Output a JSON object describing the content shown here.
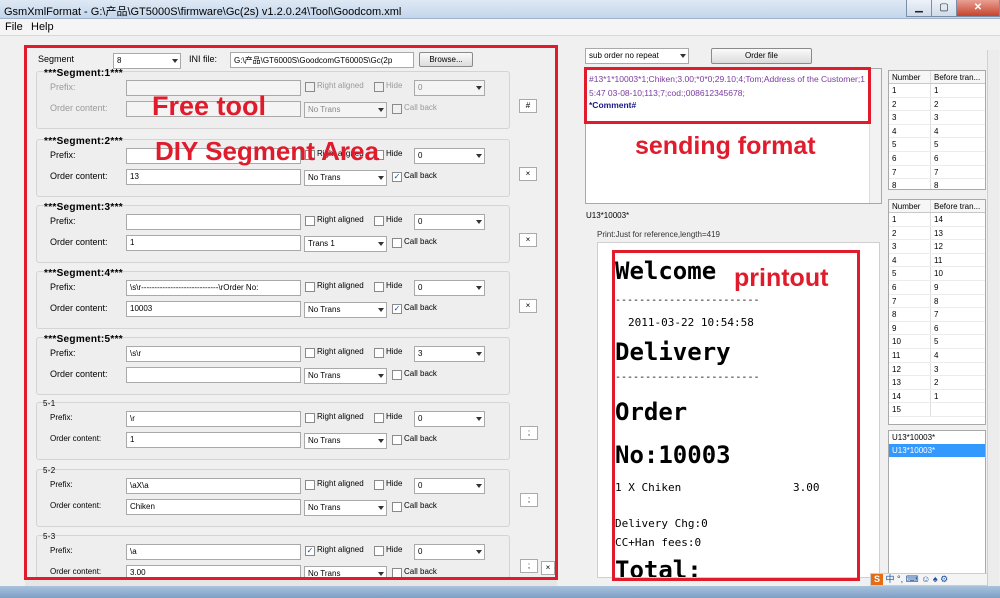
{
  "window": {
    "title": "GsmXmlFormat - G:\\产品\\GT5000S\\firmware\\Gc(2s) v1.2.0.24\\Tool\\Goodcom.xml",
    "min": "▁",
    "max": "▢",
    "close": "✕"
  },
  "menu": [
    "File",
    "Help"
  ],
  "top": {
    "segment_label": "Segment",
    "segment_value": "8",
    "ini_label": "INI file:",
    "ini_value": "G:\\产品\\GT6000S\\GoodcomGT6000S\\Gc(2p",
    "browse": "Browse..."
  },
  "labels": {
    "prefix": "Prefix:",
    "order_content": "Order content:",
    "right_aligned": "Right aligned",
    "hide": "Hide",
    "call_back": "Call back"
  },
  "segments": [
    {
      "title": "***Segment:1***",
      "prefix": "",
      "content": "",
      "align_sel": "0",
      "trans": "No Trans",
      "right": false,
      "hide": false,
      "callback": false,
      "disabled": true,
      "side": "#"
    },
    {
      "title": "***Segment:2***",
      "prefix": "",
      "content": "13",
      "align_sel": "0",
      "trans": "No Trans",
      "right": false,
      "hide": false,
      "callback": true,
      "disabled": false,
      "side": "×"
    },
    {
      "title": "***Segment:3***",
      "prefix": "",
      "content": "1",
      "align_sel": "0",
      "trans": "Trans 1",
      "right": false,
      "hide": false,
      "callback": false,
      "disabled": false,
      "side": "×"
    },
    {
      "title": "***Segment:4***",
      "prefix": "\\s\\r-----------------------------\\rOrder No:",
      "content": "10003",
      "align_sel": "0",
      "trans": "No Trans",
      "right": false,
      "hide": false,
      "callback": true,
      "disabled": false,
      "side": "×"
    },
    {
      "title": "***Segment:5***",
      "prefix": "\\s\\r",
      "content": "",
      "align_sel": "3",
      "trans": "No Trans",
      "right": false,
      "hide": false,
      "callback": false,
      "disabled": false,
      "side": ""
    },
    {
      "title": "5-1",
      "prefix": "\\r",
      "content": "1",
      "align_sel": "0",
      "trans": "No Trans",
      "right": false,
      "hide": false,
      "callback": false,
      "disabled": false,
      "side": ";"
    },
    {
      "title": "5-2",
      "prefix": "\\aX\\a",
      "content": "Chiken",
      "align_sel": "0",
      "trans": "No Trans",
      "right": false,
      "hide": false,
      "callback": false,
      "disabled": false,
      "side": ";"
    },
    {
      "title": "5-3",
      "prefix": "\\a",
      "content": "3.00",
      "align_sel": "0",
      "trans": "No Trans",
      "right": true,
      "hide": false,
      "callback": false,
      "disabled": false,
      "side": ";"
    }
  ],
  "right": {
    "order_select": "sub order no repeat",
    "order_file": "Order file",
    "sending_text": "#13*1*10003*1;Chiken;3.00;*0*0;29.10;4;Tom;Address of the Customer;15:47 03-08-10;113;7;cod:;008612345678;",
    "sending_comment": "*Comment#",
    "u13": "U13*10003*",
    "print_note": "Print:Just for reference,length=419"
  },
  "receipt": {
    "welcome": "Welcome",
    "dash1": "------------------------",
    "date": "2011-03-22 10:54:58",
    "delivery": "Delivery",
    "dash2": "------------------------",
    "order": "Order",
    "no": "No:10003",
    "item": "1 X Chiken",
    "price": "3.00",
    "chg": "Delivery Chg:0",
    "cc": "CC+Han fees:0",
    "total": "Total:"
  },
  "grid1": {
    "h1": "Number",
    "h2": "Before tran...",
    "rows": [
      [
        "1",
        "1"
      ],
      [
        "2",
        "2"
      ],
      [
        "3",
        "3"
      ],
      [
        "4",
        "4"
      ],
      [
        "5",
        "5"
      ],
      [
        "6",
        "6"
      ],
      [
        "7",
        "7"
      ],
      [
        "8",
        "8"
      ]
    ]
  },
  "grid2": {
    "h1": "Number",
    "h2": "Before tran...",
    "rows": [
      [
        "1",
        "14"
      ],
      [
        "2",
        "13"
      ],
      [
        "3",
        "12"
      ],
      [
        "4",
        "11"
      ],
      [
        "5",
        "10"
      ],
      [
        "6",
        "9"
      ],
      [
        "7",
        "8"
      ],
      [
        "8",
        "7"
      ],
      [
        "9",
        "6"
      ],
      [
        "10",
        "5"
      ],
      [
        "11",
        "4"
      ],
      [
        "12",
        "3"
      ],
      [
        "13",
        "2"
      ],
      [
        "14",
        "1"
      ],
      [
        "15",
        ""
      ]
    ]
  },
  "list": {
    "item1": "U13*10003*",
    "item2": "U13*10003*"
  },
  "annotations": {
    "free_tool": "Free tool",
    "diy": "DIY Segment Area",
    "sending": "sending format",
    "printout": "printout"
  },
  "tray": {
    "lang": "中",
    "icons": "°, ⌨ ☺ ♠ ⚙"
  },
  "colors": {
    "annotation": "#e01b2c",
    "selected_list": "#3399ff"
  }
}
